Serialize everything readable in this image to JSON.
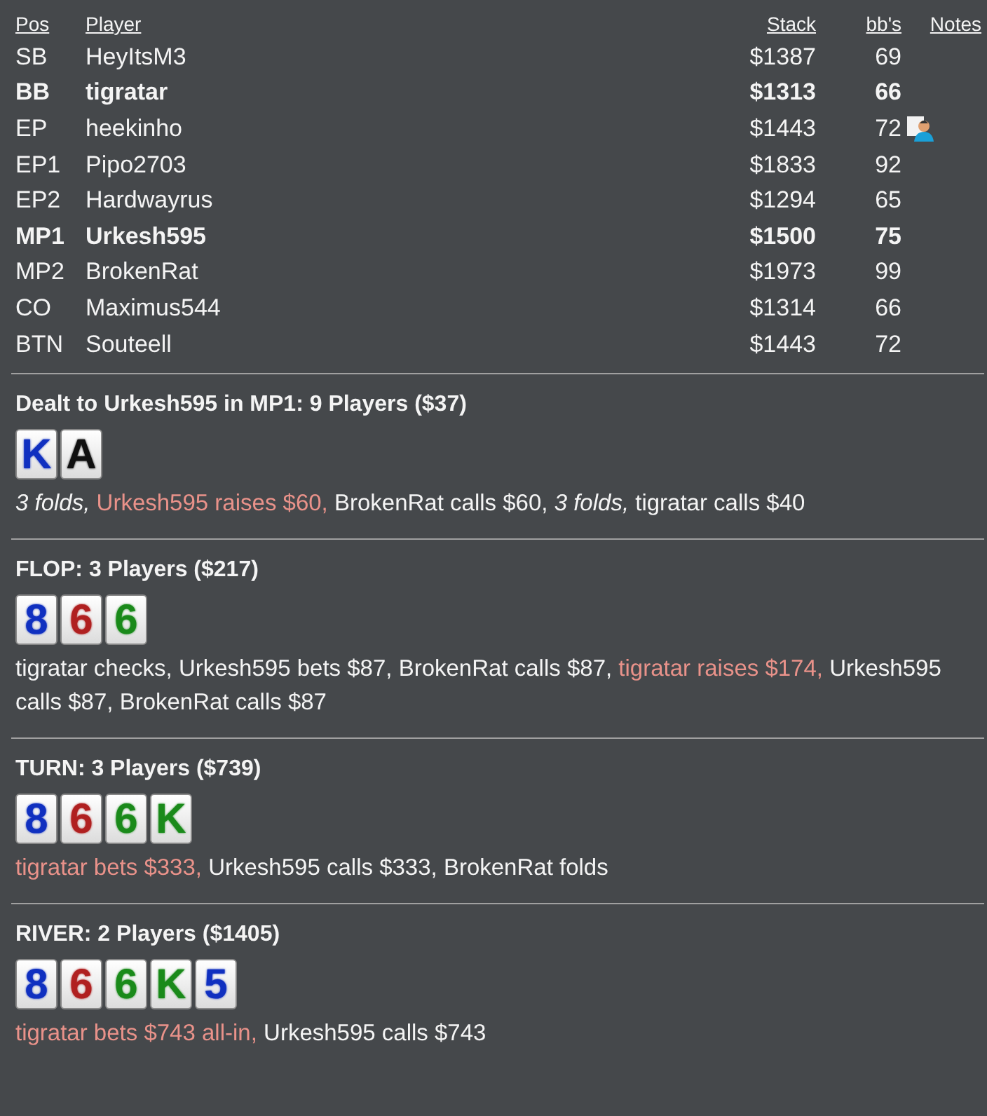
{
  "columns": [
    "Pos",
    "Player",
    "Stack",
    "bb's",
    "Notes"
  ],
  "players": [
    {
      "pos": "SB",
      "name": "HeyItsM3",
      "stack": "$1387",
      "bbs": "69",
      "highlighted": false,
      "has_note": false
    },
    {
      "pos": "BB",
      "name": "tigratar",
      "stack": "$1313",
      "bbs": "66",
      "highlighted": true,
      "has_note": false
    },
    {
      "pos": "EP",
      "name": "heekinho",
      "stack": "$1443",
      "bbs": "72",
      "highlighted": false,
      "has_note": true
    },
    {
      "pos": "EP1",
      "name": "Pipo2703",
      "stack": "$1833",
      "bbs": "92",
      "highlighted": false,
      "has_note": false
    },
    {
      "pos": "EP2",
      "name": "Hardwayrus",
      "stack": "$1294",
      "bbs": "65",
      "highlighted": false,
      "has_note": false
    },
    {
      "pos": "MP1",
      "name": "Urkesh595",
      "stack": "$1500",
      "bbs": "75",
      "highlighted": true,
      "has_note": false
    },
    {
      "pos": "MP2",
      "name": "BrokenRat",
      "stack": "$1973",
      "bbs": "99",
      "highlighted": false,
      "has_note": false
    },
    {
      "pos": "CO",
      "name": "Maximus544",
      "stack": "$1314",
      "bbs": "66",
      "highlighted": false,
      "has_note": false
    },
    {
      "pos": "BTN",
      "name": "Souteell",
      "stack": "$1443",
      "bbs": "72",
      "highlighted": false,
      "has_note": false
    }
  ],
  "streets": [
    {
      "title": "Dealt to Urkesh595 in MP1: 9 Players ($37)",
      "cards": [
        {
          "rank": "K",
          "color": "#1030c0"
        },
        {
          "rank": "A",
          "color": "#111111"
        }
      ],
      "actions": [
        {
          "text": "3 folds,",
          "kind": "fold"
        },
        {
          "text": "Urkesh595 raises $60,",
          "kind": "aggressive"
        },
        {
          "text": "BrokenRat calls $60,",
          "kind": "normal"
        },
        {
          "text": "3 folds,",
          "kind": "fold"
        },
        {
          "text": "tigratar calls $40",
          "kind": "normal"
        }
      ]
    },
    {
      "title": "FLOP: 3 Players ($217)",
      "cards": [
        {
          "rank": "8",
          "color": "#1030c0"
        },
        {
          "rank": "6",
          "color": "#b02020"
        },
        {
          "rank": "6",
          "color": "#1a8a1a"
        }
      ],
      "actions": [
        {
          "text": "tigratar checks,",
          "kind": "normal"
        },
        {
          "text": "Urkesh595 bets $87,",
          "kind": "normal"
        },
        {
          "text": "BrokenRat calls $87,",
          "kind": "normal"
        },
        {
          "text": "tigratar raises $174,",
          "kind": "aggressive"
        },
        {
          "text": "Urkesh595 calls $87,",
          "kind": "normal"
        },
        {
          "text": "BrokenRat calls $87",
          "kind": "normal"
        }
      ]
    },
    {
      "title": "TURN: 3 Players ($739)",
      "cards": [
        {
          "rank": "8",
          "color": "#1030c0"
        },
        {
          "rank": "6",
          "color": "#b02020"
        },
        {
          "rank": "6",
          "color": "#1a8a1a"
        },
        {
          "rank": "K",
          "color": "#1a8a1a"
        }
      ],
      "actions": [
        {
          "text": "tigratar bets $333,",
          "kind": "aggressive"
        },
        {
          "text": "Urkesh595 calls $333,",
          "kind": "normal"
        },
        {
          "text": "BrokenRat folds",
          "kind": "normal"
        }
      ]
    },
    {
      "title": "RIVER: 2 Players ($1405)",
      "cards": [
        {
          "rank": "8",
          "color": "#1030c0"
        },
        {
          "rank": "6",
          "color": "#b02020"
        },
        {
          "rank": "6",
          "color": "#1a8a1a"
        },
        {
          "rank": "K",
          "color": "#1a8a1a"
        },
        {
          "rank": "5",
          "color": "#1030c0"
        }
      ],
      "actions": [
        {
          "text": "tigratar bets $743 all-in,",
          "kind": "aggressive"
        },
        {
          "text": "Urkesh595 calls $743",
          "kind": "normal"
        }
      ]
    }
  ]
}
